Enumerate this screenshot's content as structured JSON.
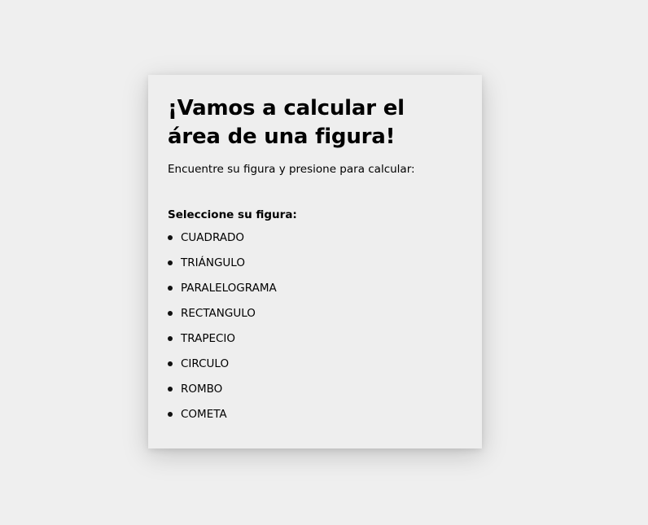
{
  "card": {
    "title": "¡Vamos a calcular el área de una figura!",
    "subtitle": "Encuentre su figura y presione para calcular:",
    "select_label": "Seleccione su figura:",
    "shapes": [
      "CUADRADO",
      "TRIÁNGULO",
      "PARALELOGRAMA",
      "RECTANGULO",
      "TRAPECIO",
      "CIRCULO",
      "ROMBO",
      "COMETA"
    ]
  }
}
